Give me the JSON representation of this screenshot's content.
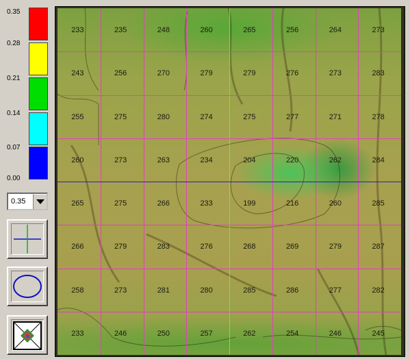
{
  "color_scale": {
    "labels": [
      "0.35",
      "0.28",
      "0.21",
      "0.14",
      "0.07",
      "0.00"
    ],
    "swatches": [
      {
        "name": "red",
        "color": "#ff0000"
      },
      {
        "name": "yellow",
        "color": "#ffff00"
      },
      {
        "name": "green",
        "color": "#00dd00"
      },
      {
        "name": "cyan",
        "color": "#00ffff"
      },
      {
        "name": "blue",
        "color": "#0000ff"
      }
    ]
  },
  "scale_dropdown": {
    "value": "0.35"
  },
  "tools": [
    {
      "name": "crosshair-tool-button",
      "icon": "crosshair-icon"
    },
    {
      "name": "ellipse-tool-button",
      "icon": "ellipse-icon"
    },
    {
      "name": "thickness-map-tool-button",
      "icon": "thickness-map-icon"
    }
  ],
  "grid": {
    "rows": 8,
    "cols": 8,
    "values": [
      [
        "233",
        "235",
        "248",
        "260",
        "265",
        "256",
        "264",
        "273"
      ],
      [
        "243",
        "256",
        "270",
        "279",
        "279",
        "276",
        "273",
        "283"
      ],
      [
        "255",
        "275",
        "280",
        "274",
        "275",
        "277",
        "271",
        "278"
      ],
      [
        "260",
        "273",
        "263",
        "234",
        "204",
        "220",
        "262",
        "284"
      ],
      [
        "265",
        "275",
        "266",
        "233",
        "199",
        "216",
        "260",
        "285"
      ],
      [
        "266",
        "279",
        "283",
        "276",
        "268",
        "269",
        "279",
        "287"
      ],
      [
        "258",
        "273",
        "281",
        "280",
        "285",
        "286",
        "277",
        "282"
      ],
      [
        "233",
        "246",
        "250",
        "257",
        "262",
        "254",
        "246",
        "245"
      ]
    ],
    "grid_line_color": "#e040c0",
    "horizontal_crosshair_color": "#2020d0",
    "vertical_crosshair_color": "#40ff40"
  }
}
